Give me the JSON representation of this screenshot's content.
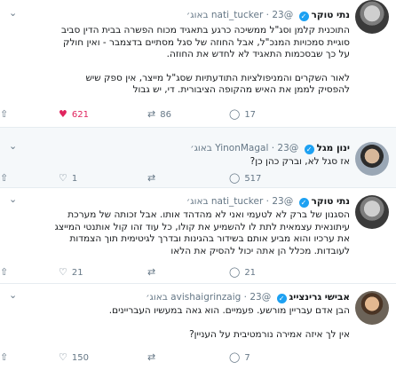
{
  "icons": {
    "verified": "✓",
    "chevron": "⌄",
    "reply": "◯",
    "retweet": "⇄",
    "like": "♡",
    "like_filled": "♥",
    "share": "⇧"
  },
  "colors": {
    "accent": "#1da1f2",
    "like": "#e0245e",
    "muted": "#657786"
  },
  "tweets": [
    {
      "name": "נתי טוקר",
      "handle": "@nati_tucker",
      "date": "23 באוג׳",
      "verified": true,
      "lines": [
        "התוכנית קלמן וסג\"ל ממשיכה כרגע בתאגיד מכוח הפשרה בבית הדין סביב",
        "סוגיית סמכויות המנכ\"ל, אבל החוזה של סגל מסתיים בדצמבר - ואין חולק",
        "על כך שבסכמות התאגיד לא לחדש את החוזה.",
        "",
        "לאור השקרים והמניפולציות התודעתיות שסג\"ל מייצר, אין ספק שיש",
        "להפסיק לממן את האיש מהקופה הציבורית. די, יש גבול"
      ],
      "reply_count": "17",
      "retweet_count": "86",
      "like_count": "621"
    },
    {
      "name": "ינון מגל",
      "handle": "@YinonMagal",
      "date": "23 באוג׳",
      "verified": true,
      "lines": [
        "אז סגל לא, וברק כהן כן?"
      ],
      "reply_count": "517",
      "retweet_count": "",
      "like_count": "1"
    },
    {
      "name": "נתי טוקר",
      "handle": "@nati_tucker",
      "date": "23 באוג׳",
      "verified": true,
      "lines": [
        "הסגנון של ברק לא לטעמי ואני לא מהדהד אותו. אבל זכותה של מערכת",
        "עיתונאית עצמאית לתת לו להשמיע את קולו, כל עוד זהו קול אותנטי המייצג",
        "את ערכיו והוא מביע אותם בשידור בהגינות ובדרך לגיטימית תוך הצמדות",
        "לעובדות. מכלל הן אתה יכול להסיק את הלאו"
      ],
      "reply_count": "21",
      "retweet_count": "",
      "like_count": "21"
    },
    {
      "name": "אבישי גרינצייג",
      "handle": "@avishaigrinzaig",
      "date": "23 באוג׳",
      "verified": true,
      "lines": [
        "הבן אדם עבריין מורשע. פעמיים. הוא גאה במעשיו העבריינים.",
        "",
        "אין לך איזה אמירה נורמטיבית על העניין?"
      ],
      "reply_count": "7",
      "retweet_count": "",
      "like_count": "150"
    }
  ]
}
